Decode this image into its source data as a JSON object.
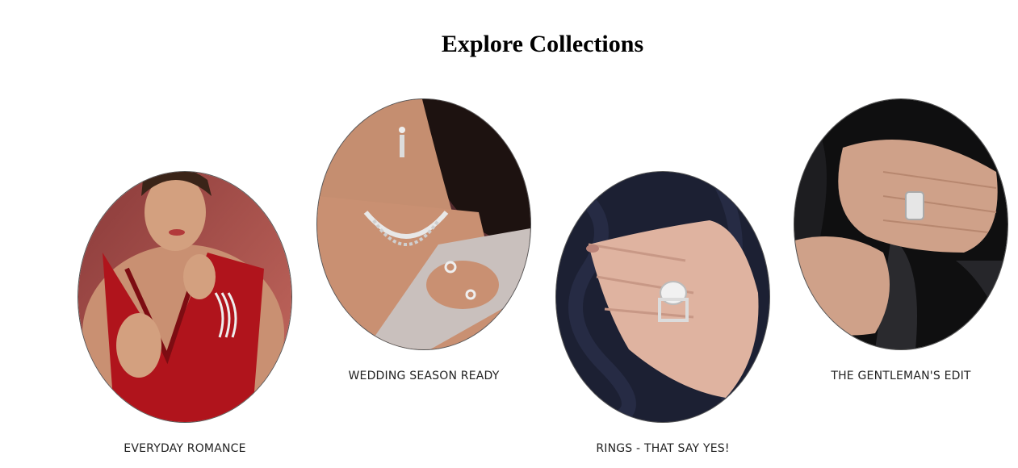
{
  "section": {
    "title": "Explore Collections"
  },
  "collections": [
    {
      "label": "EVERYDAY ROMANCE",
      "image": "woman-red-dress-jewelry"
    },
    {
      "label": "WEDDING SEASON READY",
      "image": "woman-necklace-earrings"
    },
    {
      "label": "RINGS - THAT SAY YES!",
      "image": "hand-engagement-ring"
    },
    {
      "label": "THE GENTLEMAN'S EDIT",
      "image": "man-hand-ring"
    }
  ],
  "colors": {
    "background": "#ffffff",
    "title": "#000000",
    "label": "#222222",
    "oval_border": "#555555"
  }
}
